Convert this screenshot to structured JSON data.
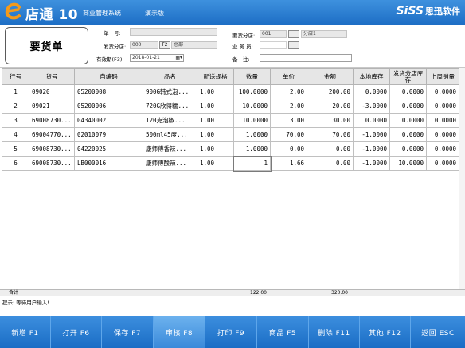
{
  "app": {
    "name": "店通 10",
    "subtitle": "商业管理系统",
    "edition": "演示版",
    "brand_latin": "SiSS",
    "brand_cn": "思迅软件"
  },
  "header": {
    "doc_title": "要货单",
    "order_no_label": "单　号:",
    "order_no_value": "",
    "ship_branch_label": "发货分店:",
    "ship_branch_code": "000",
    "ship_branch_f2": "F2",
    "ship_branch_name": "总部",
    "valid_label": "有效期(F3):",
    "valid_value": "2018-01-21",
    "req_branch_label": "要货分店:",
    "req_branch_code": "001",
    "req_branch_more": "···",
    "req_branch_name": "分店1",
    "staff_label": "业 务 员:",
    "staff_value": "",
    "staff_more": "···",
    "remark_label": "备　注:",
    "remark_value": ""
  },
  "grid": {
    "columns": [
      "行号",
      "货号",
      "自编码",
      "品名",
      "配送规格",
      "数量",
      "单价",
      "金额",
      "本地库存",
      "发货分店库存",
      "上周销量"
    ],
    "rows": [
      {
        "line": "1",
        "code": "09020",
        "self_code": "05200008",
        "name": "900G韩式泡...",
        "spec": "1.00",
        "qty": "100.0000",
        "price": "2.00",
        "amount": "200.00",
        "local_stock": "0.0000",
        "branch_stock": "0.0000",
        "last_week": "0.0000"
      },
      {
        "line": "2",
        "code": "09021",
        "self_code": "05200006",
        "name": "720G欣得糯...",
        "spec": "1.00",
        "qty": "10.0000",
        "price": "2.00",
        "amount": "20.00",
        "local_stock": "-3.0000",
        "branch_stock": "0.0000",
        "last_week": "0.0000"
      },
      {
        "line": "3",
        "code": "69008730...",
        "self_code": "04340002",
        "name": "120克泡椒...",
        "spec": "1.00",
        "qty": "10.0000",
        "price": "3.00",
        "amount": "30.00",
        "local_stock": "0.0000",
        "branch_stock": "0.0000",
        "last_week": "0.0000"
      },
      {
        "line": "4",
        "code": "69004770...",
        "self_code": "02010079",
        "name": "500ml45度...",
        "spec": "1.00",
        "qty": "1.0000",
        "price": "70.00",
        "amount": "70.00",
        "local_stock": "-1.0000",
        "branch_stock": "0.0000",
        "last_week": "0.0000"
      },
      {
        "line": "5",
        "code": "69008730...",
        "self_code": "04220025",
        "name": "康师傅香辣...",
        "spec": "1.00",
        "qty": "1.0000",
        "price": "0.00",
        "amount": "0.00",
        "local_stock": "-1.0000",
        "branch_stock": "0.0000",
        "last_week": "0.0000"
      },
      {
        "line": "6",
        "code": "69008730...",
        "self_code": "LB000016",
        "name": "康师傅酸辣...",
        "spec": "1.00",
        "qty": "1",
        "price": "1.66",
        "amount": "0.00",
        "local_stock": "-1.0000",
        "branch_stock": "10.0000",
        "last_week": "0.0000"
      }
    ]
  },
  "totals": {
    "label": "合计",
    "qty": "122.00",
    "amount": "320.00"
  },
  "status": {
    "prompt": "提示: 等待用户输入!"
  },
  "toolbar": {
    "buttons": [
      {
        "label": "新增 F1"
      },
      {
        "label": "打开 F6"
      },
      {
        "label": "保存 F7"
      },
      {
        "label": "审核 F8"
      },
      {
        "label": "打印 F9"
      },
      {
        "label": "商品 F5"
      },
      {
        "label": "删除 F11"
      },
      {
        "label": "其他 F12"
      },
      {
        "label": "返回 ESC"
      }
    ]
  },
  "colors": {
    "titlebar": "#1d6ec5",
    "toolbar": "#1a6dc5",
    "toolbar_active": "#3a8ada",
    "logo_orange": "#f39a1b"
  }
}
